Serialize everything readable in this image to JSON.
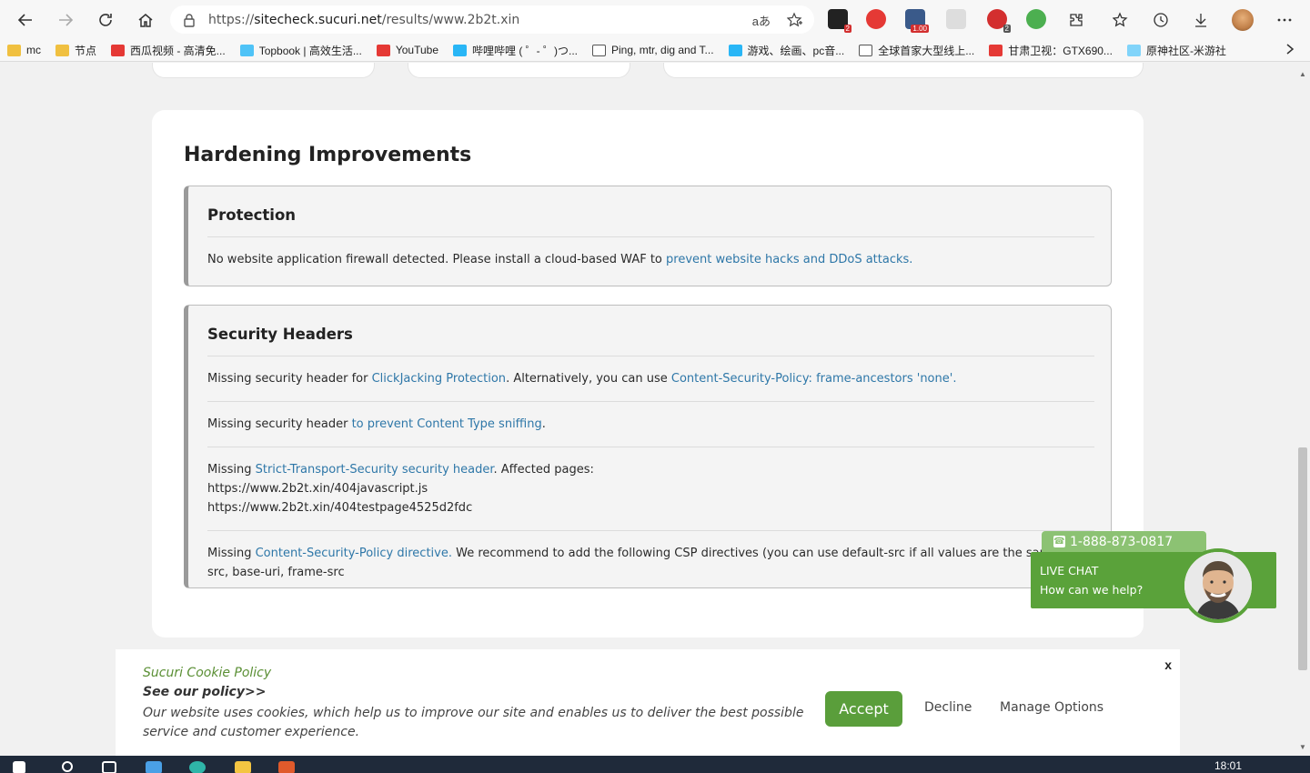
{
  "browser": {
    "url_prefix": "https://",
    "url_host": "sitecheck.sucuri.net",
    "url_path": "/results/www.2b2t.xin",
    "translate_label": "aあ",
    "ext_badges": {
      "e1": "2",
      "e2": "1.00",
      "e3": "2"
    }
  },
  "bookmarks": [
    {
      "label": "mc",
      "color": "#f0c040"
    },
    {
      "label": "节点",
      "color": "#f0c040"
    },
    {
      "label": "西瓜视频 - 高清免...",
      "color": "#e53935"
    },
    {
      "label": "Topbook | 高效生活...",
      "color": "#4fc3f7"
    },
    {
      "label": "YouTube",
      "color": "#e53935"
    },
    {
      "label": "哔哩哔哩 ( ゜- ゜)つ...",
      "color": "#29b6f6"
    },
    {
      "label": "Ping, mtr, dig and T...",
      "color": "#ffffff"
    },
    {
      "label": "游戏、绘画、pc音...",
      "color": "#29b6f6"
    },
    {
      "label": "全球首家大型线上...",
      "color": "#ffffff"
    },
    {
      "label": "甘肃卫视：GTX690...",
      "color": "#e53935"
    },
    {
      "label": "原神社区-米游社",
      "color": "#81d4fa"
    }
  ],
  "hardening": {
    "title": "Hardening Improvements",
    "protection": {
      "title": "Protection",
      "text": "No website application firewall detected. Please install a cloud-based WAF to ",
      "link": "prevent website hacks and DDoS attacks."
    },
    "headers": {
      "title": "Security Headers",
      "r1_a": "Missing security header for ",
      "r1_link1": "ClickJacking Protection",
      "r1_b": ". Alternatively, you can use ",
      "r1_link2": "Content-Security-Policy: frame-ancestors 'none'.",
      "r2_a": "Missing security header ",
      "r2_link": "to prevent Content Type sniffing",
      "r2_b": ".",
      "r3_a": "Missing ",
      "r3_link": "Strict-Transport-Security security header",
      "r3_b": ". Affected pages:",
      "r3_page1": "https://www.2b2t.xin/404javascript.js",
      "r3_page2": "https://www.2b2t.xin/404testpage4525d2fdc",
      "r4_a": "Missing ",
      "r4_link": "Content-Security-Policy directive.",
      "r4_b": " We recommend to add the following CSP directives (you can use default-src if all values are the same): script-src,",
      "r4_c": "src, base-uri, frame-src"
    }
  },
  "cookie": {
    "title": "Sucuri Cookie Policy",
    "policy_link": "See our policy>>",
    "desc": "Our website uses cookies, which help us to improve our site and enables us to deliver the best possible service and customer experience.",
    "accept": "Accept",
    "decline": "Decline",
    "manage": "Manage Options",
    "close": "x"
  },
  "chat": {
    "phone": "1-888-873-0817",
    "line1": "LIVE CHAT",
    "line2": "How can we help?"
  },
  "taskbar": {
    "clock": "18:01"
  }
}
